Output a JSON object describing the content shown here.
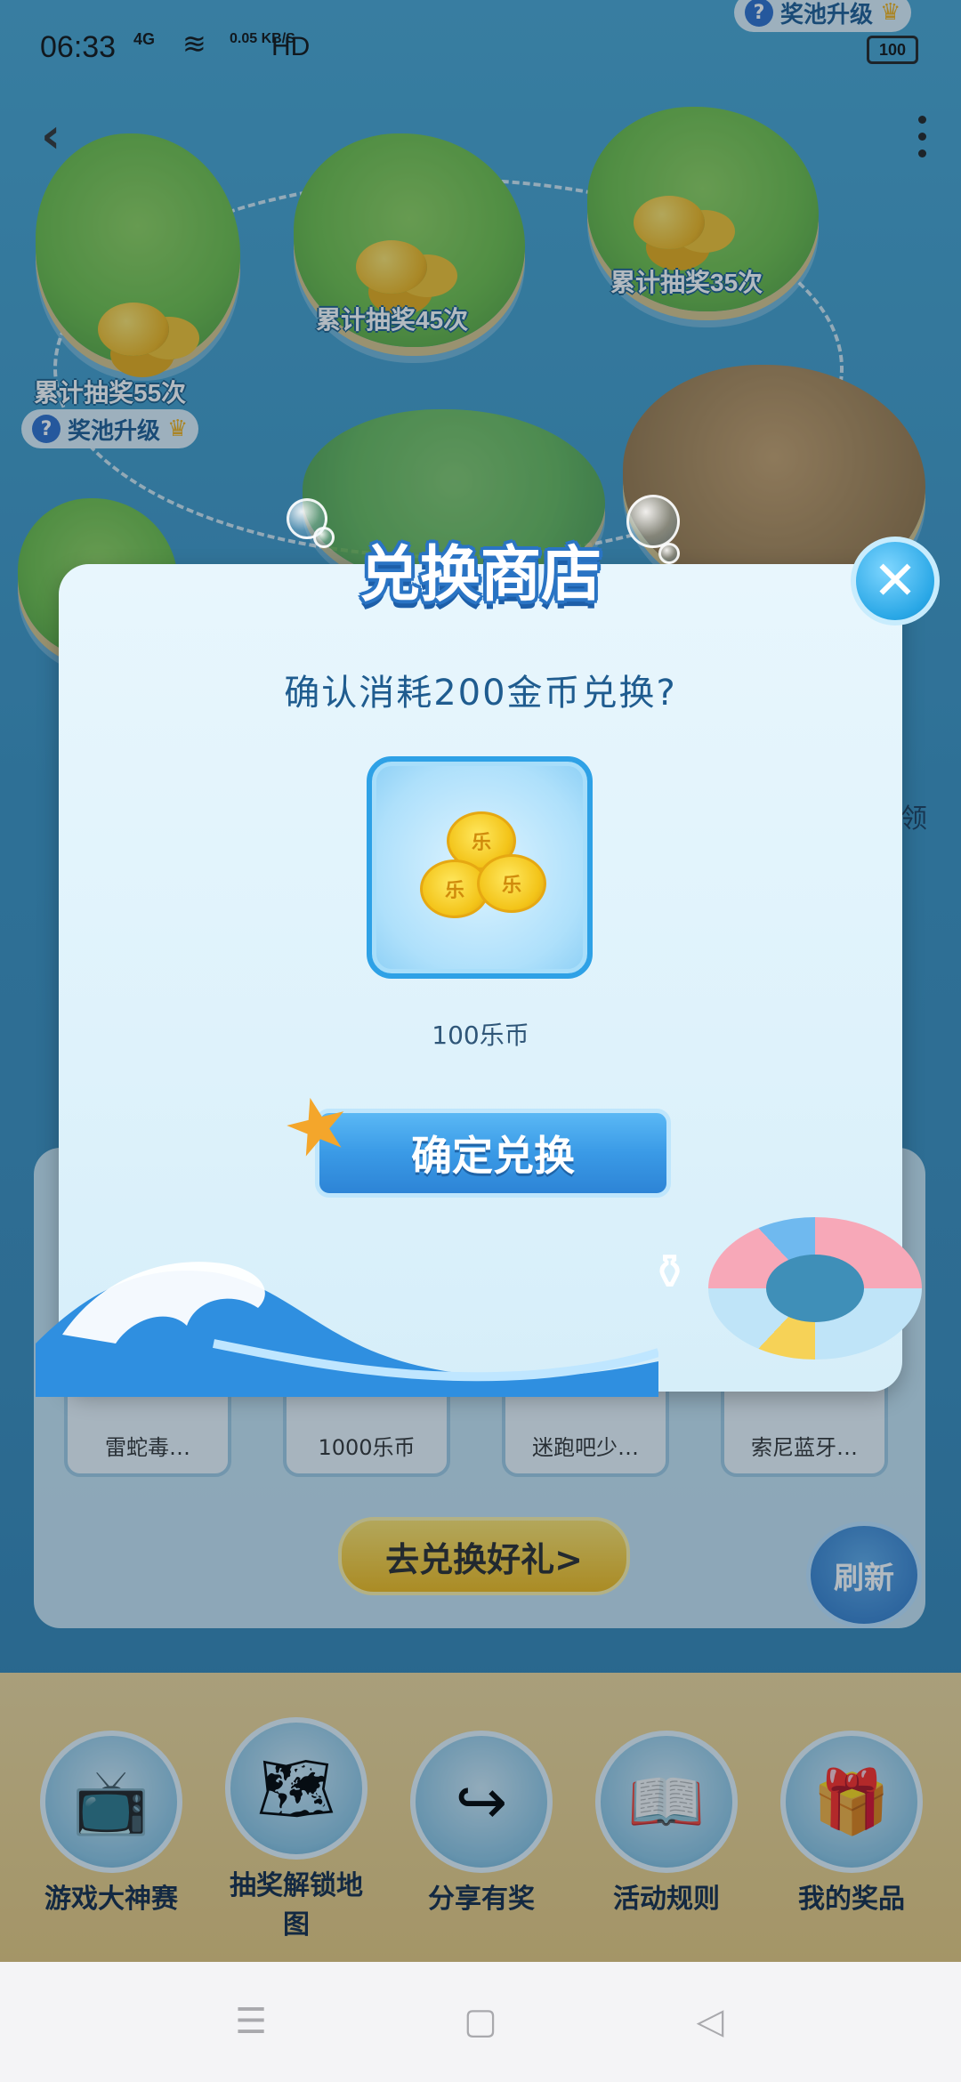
{
  "status_bar": {
    "time": "06:33",
    "network": "4G",
    "speed": "0.05 KB/S",
    "hd": "HD",
    "battery": "100"
  },
  "map": {
    "rewards": [
      {
        "label": "累计抽奖55次"
      },
      {
        "label": "累计抽奖45次"
      },
      {
        "label": "累计抽奖35次"
      }
    ],
    "pool_upgrade_label": "奖池升级",
    "pool_question": "?"
  },
  "shop": {
    "items": [
      "雷蛇毒…",
      "1000乐币",
      "迷跑吧少…",
      "索尼蓝牙…"
    ],
    "go_exchange": "去兑换好礼>",
    "refresh": "刷新",
    "side_text": "领"
  },
  "dialog": {
    "title": "兑换商店",
    "close_symbol": "✕",
    "confirm_text": "确认消耗200金币兑换?",
    "item_name": "100乐币",
    "coin_mark": "乐",
    "confirm_button": "确定兑换"
  },
  "bottom_nav": [
    {
      "label": "游戏大神赛",
      "icon": "tv-icon"
    },
    {
      "label": "抽奖解锁地图",
      "icon": "map-icon"
    },
    {
      "label": "分享有奖",
      "icon": "share-icon"
    },
    {
      "label": "活动规则",
      "icon": "book-icon"
    },
    {
      "label": "我的奖品",
      "icon": "gift-icon"
    }
  ],
  "colors": {
    "accent_blue": "#2ea1e6",
    "gold": "#f3bb1a",
    "title_stroke": "#2a74c4"
  }
}
